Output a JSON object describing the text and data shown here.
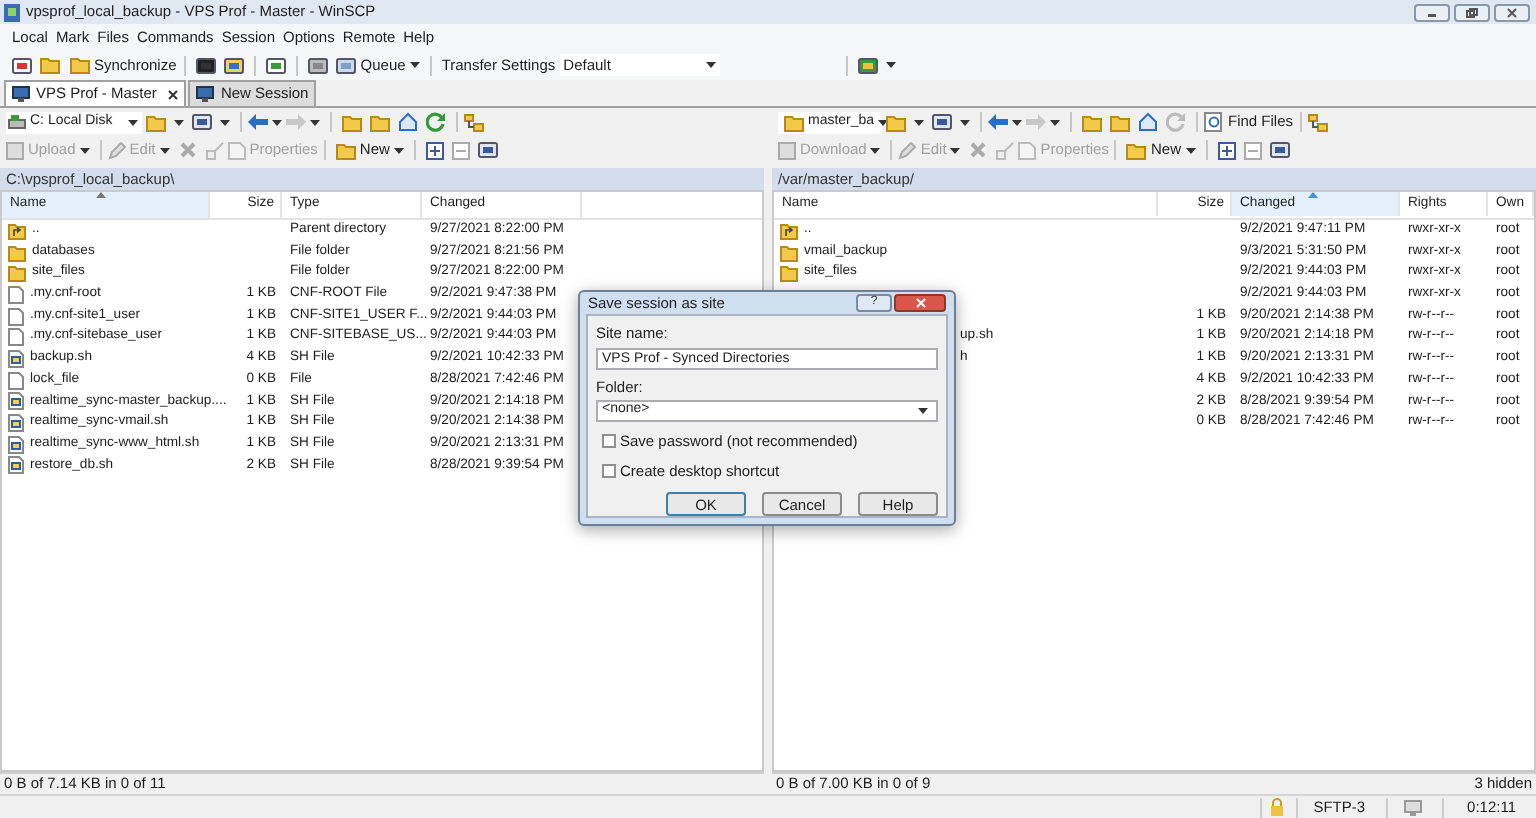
{
  "window": {
    "title": "vpsprof_local_backup - VPS Prof - Master - WinSCP"
  },
  "menu": [
    "Local",
    "Mark",
    "Files",
    "Commands",
    "Session",
    "Options",
    "Remote",
    "Help"
  ],
  "toolbar": {
    "synchronize": "Synchronize",
    "queue": "Queue",
    "transfer_label": "Transfer Settings",
    "transfer_value": "Default"
  },
  "tabs": [
    {
      "label": "VPS Prof - Master",
      "selected": true
    },
    {
      "label": "New Session",
      "selected": false
    }
  ],
  "left_panel": {
    "location": "C: Local Disk",
    "buttons": [
      {
        "label": "Upload",
        "disabled": true
      },
      {
        "label": "Edit",
        "disabled": true
      },
      {
        "label": "Properties",
        "disabled": true
      },
      {
        "label": "New",
        "disabled": false
      }
    ],
    "path": "C:\\vpsprof_local_backup\\",
    "columns": [
      {
        "label": "Name",
        "sorted": true
      },
      {
        "label": "Size",
        "sorted": false
      },
      {
        "label": "Type",
        "sorted": false
      },
      {
        "label": "Changed",
        "sorted": false
      }
    ],
    "rows": [
      {
        "kind": "parent",
        "cells": [
          "..",
          "",
          "Parent directory",
          "9/27/2021 8:22:00 PM"
        ]
      },
      {
        "kind": "folder",
        "cells": [
          "databases",
          "",
          "File folder",
          "9/27/2021 8:21:56 PM"
        ]
      },
      {
        "kind": "folder",
        "cells": [
          "site_files",
          "",
          "File folder",
          "9/27/2021 8:22:00 PM"
        ]
      },
      {
        "kind": "file",
        "cells": [
          ".my.cnf-root",
          "1 KB",
          "CNF-ROOT File",
          "9/2/2021 9:47:38 PM"
        ]
      },
      {
        "kind": "file",
        "cells": [
          ".my.cnf-site1_user",
          "1 KB",
          "CNF-SITE1_USER F...",
          "9/2/2021 9:44:03 PM"
        ]
      },
      {
        "kind": "file",
        "cells": [
          ".my.cnf-sitebase_user",
          "1 KB",
          "CNF-SITEBASE_US...",
          "9/2/2021 9:44:03 PM"
        ]
      },
      {
        "kind": "script",
        "cells": [
          "backup.sh",
          "4 KB",
          "SH File",
          "9/2/2021 10:42:33 PM"
        ]
      },
      {
        "kind": "file",
        "cells": [
          "lock_file",
          "0 KB",
          "File",
          "8/28/2021 7:42:46 PM"
        ]
      },
      {
        "kind": "script",
        "cells": [
          "realtime_sync-master_backup....",
          "1 KB",
          "SH File",
          "9/20/2021 2:14:18 PM"
        ]
      },
      {
        "kind": "script",
        "cells": [
          "realtime_sync-vmail.sh",
          "1 KB",
          "SH File",
          "9/20/2021 2:14:38 PM"
        ]
      },
      {
        "kind": "script",
        "cells": [
          "realtime_sync-www_html.sh",
          "1 KB",
          "SH File",
          "9/20/2021 2:13:31 PM"
        ]
      },
      {
        "kind": "script",
        "cells": [
          "restore_db.sh",
          "2 KB",
          "SH File",
          "8/28/2021 9:39:54 PM"
        ]
      }
    ],
    "status": "0 B of 7.14 KB in 0 of 11"
  },
  "right_panel": {
    "location": "master_ba",
    "find_files": "Find Files",
    "buttons": [
      {
        "label": "Download",
        "disabled": true
      },
      {
        "label": "Edit",
        "disabled": true
      },
      {
        "label": "Properties",
        "disabled": true
      },
      {
        "label": "New",
        "disabled": false
      }
    ],
    "path": "/var/master_backup/",
    "columns": [
      {
        "label": "Name",
        "sorted": false
      },
      {
        "label": "Size",
        "sorted": false
      },
      {
        "label": "Changed",
        "sorted": true
      },
      {
        "label": "Rights",
        "sorted": false
      },
      {
        "label": "Own",
        "sorted": false
      }
    ],
    "rows": [
      {
        "kind": "parent",
        "cells": [
          "..",
          "",
          "9/2/2021 9:47:11 PM",
          "rwxr-xr-x",
          "root"
        ]
      },
      {
        "kind": "folder",
        "cells": [
          "vmail_backup",
          "",
          "9/3/2021 5:31:50 PM",
          "rwxr-xr-x",
          "root"
        ]
      },
      {
        "kind": "folder",
        "cells": [
          "site_files",
          "",
          "9/2/2021 9:44:03 PM",
          "rwxr-xr-x",
          "root"
        ]
      },
      {
        "cells": [
          "",
          "",
          "9/2/2021 9:44:03 PM",
          "rwxr-xr-x",
          "root"
        ]
      },
      {
        "cells": [
          "",
          "1 KB",
          "9/20/2021 2:14:38 PM",
          "rw-r--r--",
          "root"
        ]
      },
      {
        "cells": [
          "up.sh",
          "1 KB",
          "9/20/2021 2:14:18 PM",
          "rw-r--r--",
          "root"
        ]
      },
      {
        "cells": [
          "h",
          "1 KB",
          "9/20/2021 2:13:31 PM",
          "rw-r--r--",
          "root"
        ]
      },
      {
        "cells": [
          "",
          "4 KB",
          "9/2/2021 10:42:33 PM",
          "rw-r--r--",
          "root"
        ]
      },
      {
        "cells": [
          "",
          "2 KB",
          "8/28/2021 9:39:54 PM",
          "rw-r--r--",
          "root"
        ]
      },
      {
        "cells": [
          "",
          "0 KB",
          "8/28/2021 7:42:46 PM",
          "rw-r--r--",
          "root"
        ]
      }
    ],
    "status": "0 B of 7.00 KB in 0 of 9",
    "hidden": "3 hidden"
  },
  "bottom_bar": {
    "protocol": "SFTP-3",
    "time": "0:12:11"
  },
  "dialog": {
    "title": "Save session as site",
    "help_button": "?",
    "site_name_label": "Site name:",
    "site_name_value": "VPS Prof - Synced Directories",
    "folder_label": "Folder:",
    "folder_value": "<none>",
    "checkboxes": [
      {
        "label": "Save password (not recommended)",
        "checked": false
      },
      {
        "label": "Create desktop shortcut",
        "checked": false
      }
    ],
    "buttons": [
      {
        "label": "OK",
        "default": true
      },
      {
        "label": "Cancel",
        "default": false
      },
      {
        "label": "Help",
        "default": false
      }
    ]
  }
}
